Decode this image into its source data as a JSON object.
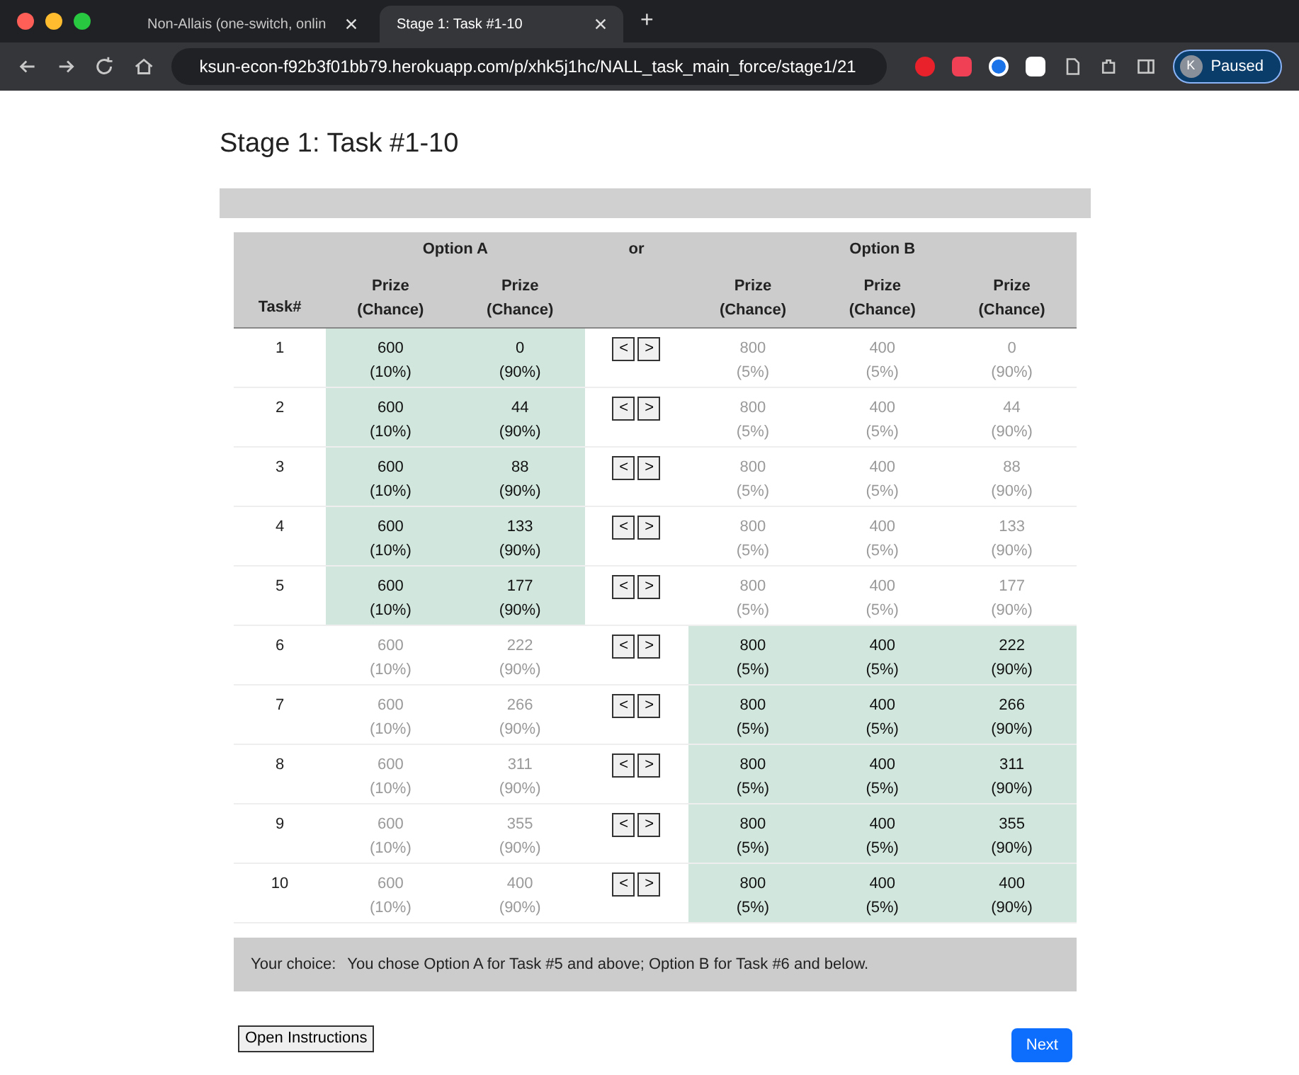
{
  "browser": {
    "tabs": [
      {
        "title": "Non-Allais (one-switch, onlin",
        "selected": false
      },
      {
        "title": "Stage 1: Task #1-10",
        "selected": true
      }
    ],
    "new_tab": "+",
    "url": "ksun-econ-f92b3f01bb79.herokuapp.com/p/xhk5j1hc/NALL_task_main_force/stage1/21",
    "profile": {
      "initial": "K",
      "label": "Paused"
    }
  },
  "page": {
    "title": "Stage 1: Task #1-10",
    "table": {
      "group_headers": [
        "Option A",
        "or",
        "Option B"
      ],
      "task_header": "Task#",
      "a_headers": [
        [
          "Prize",
          "(Chance)"
        ],
        [
          "Prize",
          "(Chance)"
        ]
      ],
      "b_headers": [
        [
          "Prize",
          "(Chance)"
        ],
        [
          "Prize",
          "(Chance)"
        ],
        [
          "Prize",
          "(Chance)"
        ]
      ],
      "rows": [
        {
          "task": "1",
          "option_a_selected": true,
          "a": [
            [
              "600",
              "(10%)"
            ],
            [
              "0",
              "(90%)"
            ]
          ],
          "b": [
            [
              "800",
              "(5%)"
            ],
            [
              "400",
              "(5%)"
            ],
            [
              "0",
              "(90%)"
            ]
          ]
        },
        {
          "task": "2",
          "option_a_selected": true,
          "a": [
            [
              "600",
              "(10%)"
            ],
            [
              "44",
              "(90%)"
            ]
          ],
          "b": [
            [
              "800",
              "(5%)"
            ],
            [
              "400",
              "(5%)"
            ],
            [
              "44",
              "(90%)"
            ]
          ]
        },
        {
          "task": "3",
          "option_a_selected": true,
          "a": [
            [
              "600",
              "(10%)"
            ],
            [
              "88",
              "(90%)"
            ]
          ],
          "b": [
            [
              "800",
              "(5%)"
            ],
            [
              "400",
              "(5%)"
            ],
            [
              "88",
              "(90%)"
            ]
          ]
        },
        {
          "task": "4",
          "option_a_selected": true,
          "a": [
            [
              "600",
              "(10%)"
            ],
            [
              "133",
              "(90%)"
            ]
          ],
          "b": [
            [
              "800",
              "(5%)"
            ],
            [
              "400",
              "(5%)"
            ],
            [
              "133",
              "(90%)"
            ]
          ]
        },
        {
          "task": "5",
          "option_a_selected": true,
          "a": [
            [
              "600",
              "(10%)"
            ],
            [
              "177",
              "(90%)"
            ]
          ],
          "b": [
            [
              "800",
              "(5%)"
            ],
            [
              "400",
              "(5%)"
            ],
            [
              "177",
              "(90%)"
            ]
          ]
        },
        {
          "task": "6",
          "option_a_selected": false,
          "a": [
            [
              "600",
              "(10%)"
            ],
            [
              "222",
              "(90%)"
            ]
          ],
          "b": [
            [
              "800",
              "(5%)"
            ],
            [
              "400",
              "(5%)"
            ],
            [
              "222",
              "(90%)"
            ]
          ]
        },
        {
          "task": "7",
          "option_a_selected": false,
          "a": [
            [
              "600",
              "(10%)"
            ],
            [
              "266",
              "(90%)"
            ]
          ],
          "b": [
            [
              "800",
              "(5%)"
            ],
            [
              "400",
              "(5%)"
            ],
            [
              "266",
              "(90%)"
            ]
          ]
        },
        {
          "task": "8",
          "option_a_selected": false,
          "a": [
            [
              "600",
              "(10%)"
            ],
            [
              "311",
              "(90%)"
            ]
          ],
          "b": [
            [
              "800",
              "(5%)"
            ],
            [
              "400",
              "(5%)"
            ],
            [
              "311",
              "(90%)"
            ]
          ]
        },
        {
          "task": "9",
          "option_a_selected": false,
          "a": [
            [
              "600",
              "(10%)"
            ],
            [
              "355",
              "(90%)"
            ]
          ],
          "b": [
            [
              "800",
              "(5%)"
            ],
            [
              "400",
              "(5%)"
            ],
            [
              "355",
              "(90%)"
            ]
          ]
        },
        {
          "task": "10",
          "option_a_selected": false,
          "a": [
            [
              "600",
              "(10%)"
            ],
            [
              "400",
              "(90%)"
            ]
          ],
          "b": [
            [
              "800",
              "(5%)"
            ],
            [
              "400",
              "(5%)"
            ],
            [
              "400",
              "(90%)"
            ]
          ]
        }
      ],
      "left_button": "<",
      "right_button": ">"
    },
    "choice_label": "Your choice:",
    "choice_text": "You chose Option A for Task #5 and above; Option B for Task #6 and below.",
    "instructions_button": "Open Instructions",
    "next_button": "Next"
  }
}
